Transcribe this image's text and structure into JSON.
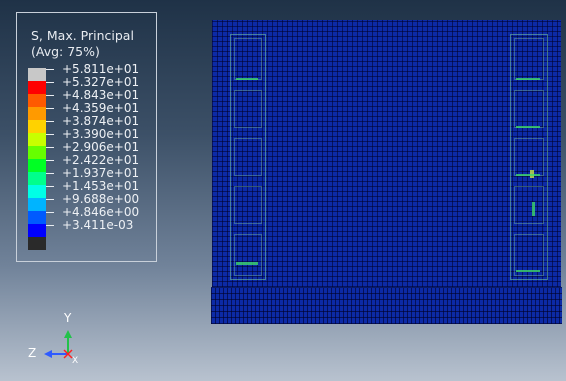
{
  "legend": {
    "title": "S, Max. Principal",
    "subtitle": "(Avg: 75%)",
    "entries": [
      {
        "label": "+5.811e+01",
        "color": "#c8c8c8"
      },
      {
        "label": "+5.327e+01",
        "color": "#ff0000"
      },
      {
        "label": "+4.843e+01",
        "color": "#ff5a00"
      },
      {
        "label": "+4.359e+01",
        "color": "#ff9a00"
      },
      {
        "label": "+3.874e+01",
        "color": "#ffd200"
      },
      {
        "label": "+3.390e+01",
        "color": "#c8ff00"
      },
      {
        "label": "+2.906e+01",
        "color": "#66ff00"
      },
      {
        "label": "+2.422e+01",
        "color": "#00ff24"
      },
      {
        "label": "+1.937e+01",
        "color": "#00ff8c"
      },
      {
        "label": "+1.453e+01",
        "color": "#00ffe6"
      },
      {
        "label": "+9.688e+00",
        "color": "#00b4ff"
      },
      {
        "label": "+4.846e+00",
        "color": "#005aff"
      },
      {
        "label": "+3.411e-03",
        "color": "#0000ff"
      },
      {
        "label": "",
        "color": "#2a2a2a"
      }
    ]
  },
  "triad": {
    "y_label": "Y",
    "z_label": "Z",
    "x_label": "X"
  },
  "colors": {
    "mesh": "#0c2aa6",
    "triad_y": "#22c24a",
    "triad_z": "#2f5bff",
    "triad_x": "#ff2020"
  }
}
